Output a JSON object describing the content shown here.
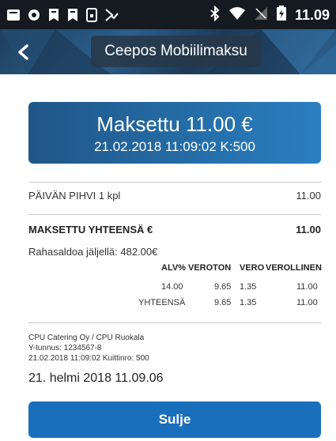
{
  "status_bar": {
    "time": "11.09",
    "icons": [
      "notification-square-icon",
      "record-icon",
      "bookmark-icon",
      "bookmark-icon",
      "sim-icon",
      "check-flag-icon",
      "bluetooth-icon",
      "wifi-icon",
      "signal-icon",
      "battery-icon"
    ]
  },
  "header": {
    "title": "Ceepos Mobiilimaksu",
    "back_glyph": "<"
  },
  "receipt": {
    "paid_title": "Maksettu 11.00 €",
    "paid_subtitle": "21.02.2018 11:09:02 K:500",
    "item": {
      "name": "PÄIVÄN PIHVI 1 kpl",
      "price": "11.00"
    },
    "total": {
      "label": "MAKSETTU YHTEENSÄ €",
      "value": "11.00"
    },
    "balance": "Rahasaldoa jäljellä: 482.00€",
    "vat": {
      "headers": [
        "ALV%",
        "VEROTON",
        "VERO",
        "VEROLLINEN"
      ],
      "rows": [
        [
          "14.00",
          "9.65",
          "1.35",
          "11.00"
        ],
        [
          "YHTEENSÄ",
          "9.65",
          "1.35",
          "11.00"
        ]
      ]
    },
    "company": {
      "name": "CPU Catering Oy / CPU Ruokala",
      "business_id": "Y-tunnus: 1234567-8",
      "receipt_line": "21.02.2018 11:09:02 Kuittinro: 500"
    },
    "date_display": "21. helmi 2018 11.09.06"
  },
  "actions": {
    "close_label": "Sulje"
  },
  "colors": {
    "header": "#2b5f8c",
    "banner_start": "#1f5688",
    "banner_end": "#2a7fc0",
    "button": "#1a6fbd",
    "status_bar": "#151a20"
  }
}
